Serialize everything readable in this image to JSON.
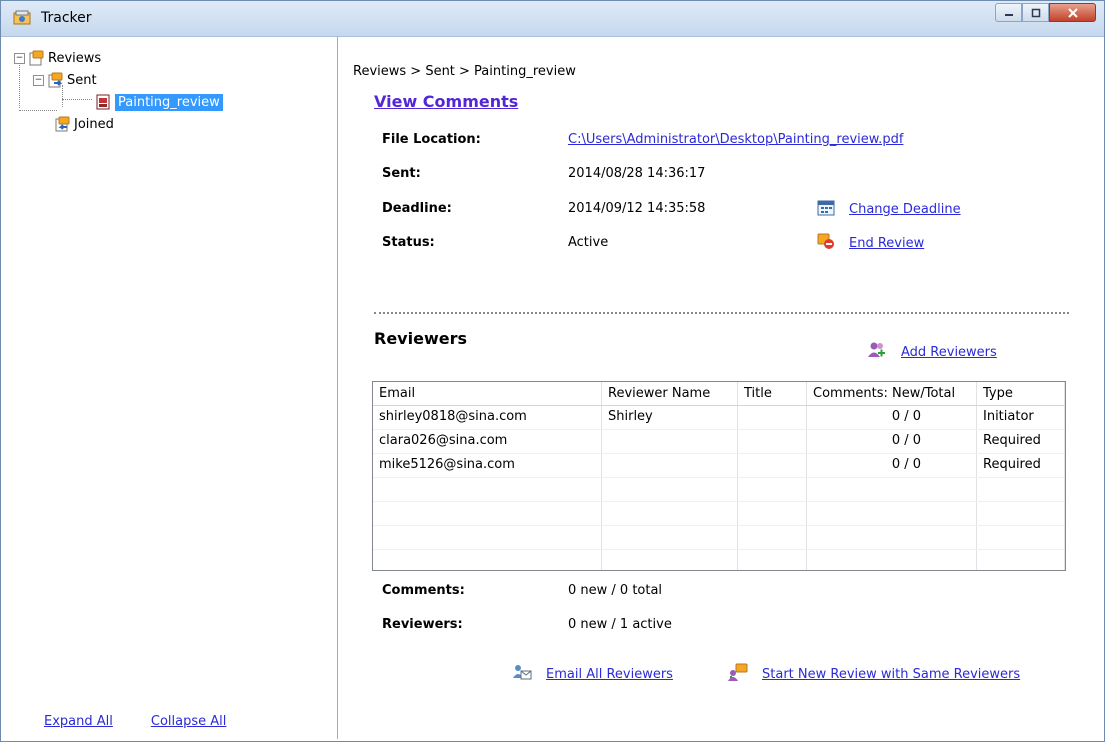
{
  "window": {
    "title": "Tracker"
  },
  "tree": {
    "root": "Reviews",
    "sent": "Sent",
    "selected": "Painting_review",
    "joined": "Joined"
  },
  "left_links": {
    "expand": "Expand All",
    "collapse": "Collapse All"
  },
  "breadcrumb": "Reviews > Sent > Painting_review",
  "view_comments": "View Comments",
  "info": {
    "file_location_label": "File Location:",
    "file_location_value": "C:\\Users\\Administrator\\Desktop\\Painting_review.pdf",
    "sent_label": "Sent:",
    "sent_value": "2014/08/28 14:36:17",
    "deadline_label": "Deadline:",
    "deadline_value": "2014/09/12 14:35:58",
    "status_label": "Status:",
    "status_value": "Active",
    "change_deadline": "Change Deadline",
    "end_review": "End Review"
  },
  "reviewers_heading": "Reviewers",
  "add_reviewers": "Add Reviewers",
  "table": {
    "headers": [
      "Email",
      "Reviewer Name",
      "Title",
      "Comments: New/Total",
      "Type"
    ],
    "rows": [
      [
        "shirley0818@sina.com",
        "Shirley",
        "",
        "0 / 0",
        "Initiator"
      ],
      [
        "clara026@sina.com",
        "",
        "",
        "0 / 0",
        "Required"
      ],
      [
        "mike5126@sina.com",
        "",
        "",
        "0 / 0",
        "Required"
      ]
    ]
  },
  "summary": {
    "comments_label": "Comments:",
    "comments_value": "0 new / 0 total",
    "reviewers_label": "Reviewers:",
    "reviewers_value": "0 new / 1 active"
  },
  "bottom_actions": {
    "email_all": "Email All Reviewers",
    "start_new": "Start New Review with Same Reviewers"
  }
}
